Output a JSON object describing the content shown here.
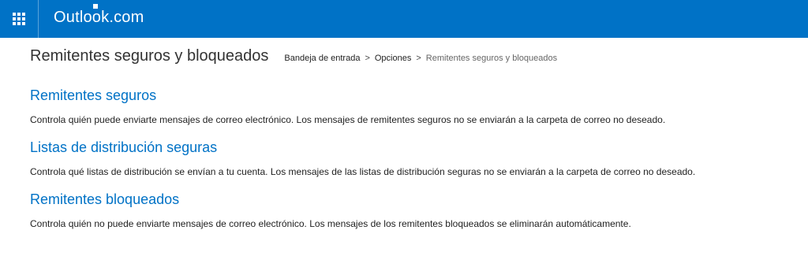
{
  "header": {
    "brand": "Outlook.com",
    "app_launcher_icon": "waffle-icon",
    "colors": {
      "bar": "#0072c6",
      "text": "#ffffff"
    }
  },
  "page": {
    "title": "Remitentes seguros y bloqueados",
    "breadcrumb": [
      "Bandeja de entrada",
      "Opciones",
      "Remitentes seguros y bloqueados"
    ],
    "breadcrumb_separator": ">"
  },
  "sections": [
    {
      "heading": "Remitentes seguros",
      "description": "Controla quién puede enviarte mensajes de correo electrónico. Los mensajes de remitentes seguros no se enviarán a la carpeta de correo no deseado."
    },
    {
      "heading": "Listas de distribución seguras",
      "description": "Controla qué listas de distribución se envían a tu cuenta. Los mensajes de las listas de distribución seguras no se enviarán a la carpeta de correo no deseado."
    },
    {
      "heading": "Remitentes bloqueados",
      "description": "Controla quién no puede enviarte mensajes de correo electrónico. Los mensajes de los remitentes bloqueados se eliminarán automáticamente."
    }
  ],
  "colors": {
    "accent": "#0072c6",
    "heading": "#0072c6",
    "body_text": "#222222"
  }
}
